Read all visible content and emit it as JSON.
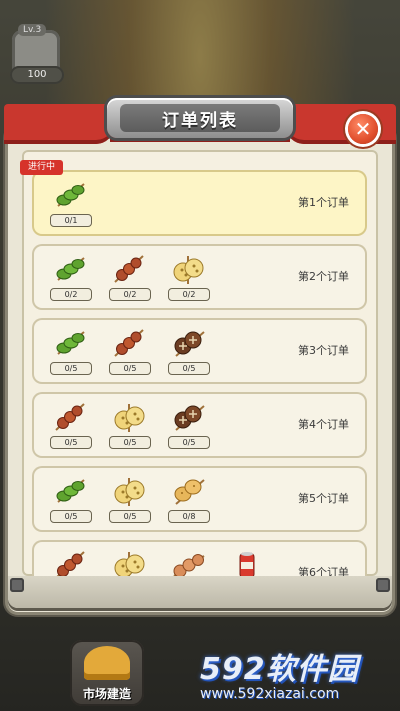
{
  "hud": {
    "level_tag": "Lv.3",
    "coins": "100"
  },
  "dialog": {
    "title": "订单列表",
    "close_symbol": "✕",
    "status_badge": "进行中"
  },
  "orders": [
    {
      "label": "第1个订单",
      "active": true,
      "items": [
        {
          "icon": "green-pepper-skewer",
          "count": "0/1"
        }
      ]
    },
    {
      "label": "第2个订单",
      "items": [
        {
          "icon": "green-pepper-skewer",
          "count": "0/2"
        },
        {
          "icon": "meat-skewer",
          "count": "0/2"
        },
        {
          "icon": "lotus-root-skewer",
          "count": "0/2"
        }
      ]
    },
    {
      "label": "第3个订单",
      "items": [
        {
          "icon": "green-pepper-skewer",
          "count": "0/5"
        },
        {
          "icon": "meat-skewer",
          "count": "0/5"
        },
        {
          "icon": "mushroom-skewer",
          "count": "0/5"
        }
      ]
    },
    {
      "label": "第4个订单",
      "items": [
        {
          "icon": "meat-skewer",
          "count": "0/5"
        },
        {
          "icon": "lotus-root-skewer",
          "count": "0/5"
        },
        {
          "icon": "mushroom-skewer",
          "count": "0/5"
        }
      ]
    },
    {
      "label": "第5个订单",
      "items": [
        {
          "icon": "green-pepper-skewer",
          "count": "0/5"
        },
        {
          "icon": "lotus-root-skewer",
          "count": "0/5"
        },
        {
          "icon": "potato-skewer",
          "count": "0/8"
        }
      ]
    },
    {
      "label": "第6个订单",
      "items": [
        {
          "icon": "meat-skewer",
          "count": ""
        },
        {
          "icon": "lotus-root-skewer",
          "count": ""
        },
        {
          "icon": "meatball-skewer",
          "count": ""
        },
        {
          "icon": "soda-can",
          "count": ""
        }
      ]
    }
  ],
  "bottom": {
    "market_button": "市场建造"
  },
  "watermark": {
    "brand": "592软件园",
    "url": "www.592xiazai.com"
  },
  "colors": {
    "badge_red": "#d6332b",
    "curtain_red": "#c9372e",
    "active_card": "#fdf5c6"
  }
}
